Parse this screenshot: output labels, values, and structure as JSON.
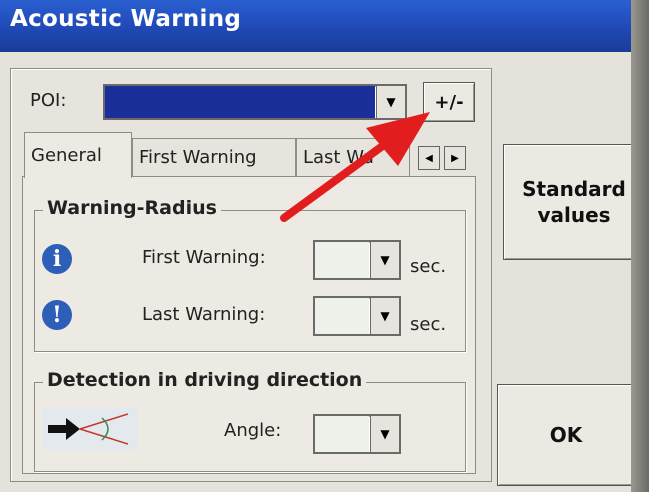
{
  "window": {
    "title": "Acoustic Warning"
  },
  "poi": {
    "label": "POI:",
    "selected": "",
    "plus_minus": "+/-"
  },
  "tabs": [
    {
      "label": "General",
      "active": true
    },
    {
      "label": "First Warning",
      "active": false
    },
    {
      "label": "Last Wa",
      "active": false
    }
  ],
  "warning_radius": {
    "title": "Warning-Radius",
    "first": {
      "label": "First Warning:",
      "value": "",
      "unit": "sec.",
      "icon": "info-icon"
    },
    "last": {
      "label": "Last Warning:",
      "value": "",
      "unit": "sec.",
      "icon": "exclamation-icon"
    }
  },
  "detection": {
    "title": "Detection in driving direction",
    "angle_label": "Angle:",
    "angle_value": "",
    "icon": "direction-cone-icon"
  },
  "buttons": {
    "standard_values": "Standard values",
    "ok": "OK"
  },
  "colors": {
    "title_bar": "#1f47b3",
    "poi_combo_selected": "#1a2f9a",
    "icon_blue": "#2e5fb8",
    "annotation_arrow": "#e11d1d"
  }
}
